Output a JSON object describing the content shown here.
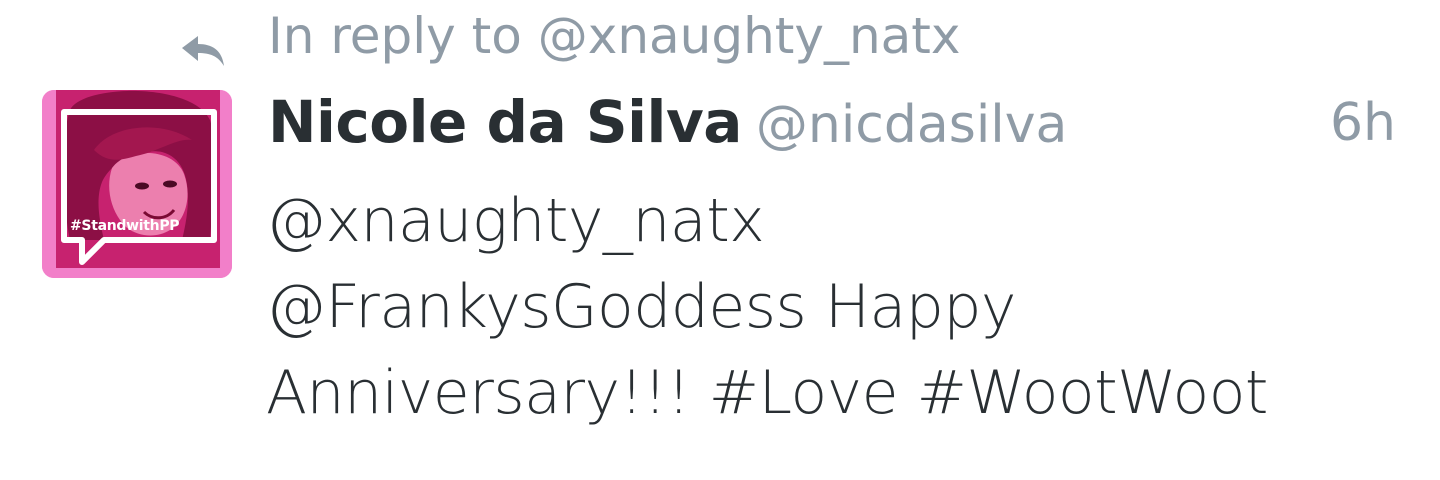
{
  "reply": {
    "icon": "reply-arrow-icon",
    "text": "In reply to @xnaughty_natx"
  },
  "tweet": {
    "author_name": "Nicole da Silva",
    "author_handle": "@nicdasilva",
    "timestamp": "6h",
    "body_lines": [
      "@xnaughty_natx",
      "@FrankysGoddess Happy",
      "Anniversary!!! #Love #WootWoot"
    ]
  },
  "avatar": {
    "badge_text": "#StandwithPP",
    "frame_color": "#f27fc9",
    "tint_color": "#d0307f"
  },
  "colors": {
    "text_primary": "#292f33",
    "text_secondary": "#8f9ba6"
  }
}
